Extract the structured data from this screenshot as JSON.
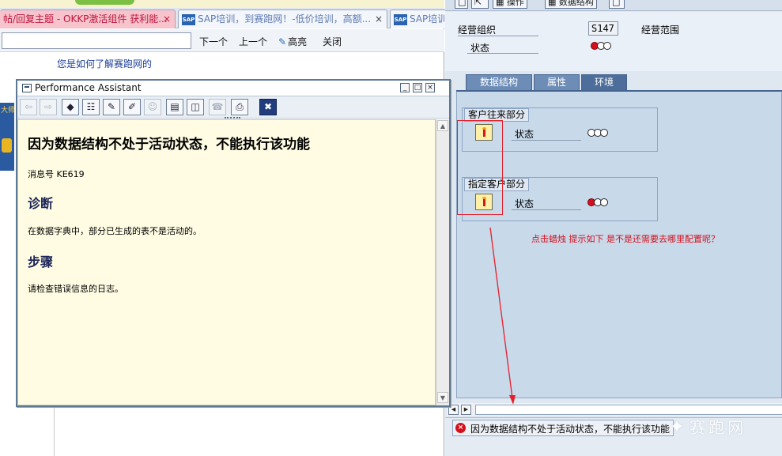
{
  "browser": {
    "tabs": [
      {
        "label": "帖/回复主题 - OKKP激活组件 获利能...",
        "close": "×"
      },
      {
        "label": "SAP培训，到赛跑网！-低价培训，高额...",
        "logo": "SAP",
        "close": "×"
      },
      {
        "label": "SAP培训",
        "logo": "SAP"
      }
    ],
    "find": {
      "value": "",
      "next": "下一个",
      "prev": "上一个",
      "highlight": "高亮",
      "close": "关闭"
    },
    "help_link": "您是如何了解赛跑网的",
    "side_label": "大师"
  },
  "pa": {
    "title": "Performance Assistant",
    "toolbar": [
      "⇦",
      "⇨",
      "◆",
      "☷",
      "✎",
      "✐",
      "☺",
      "▤",
      "◫",
      "☎",
      "⎙",
      "✖"
    ],
    "heading": "因为数据结构不处于活动状态，不能执行该功能",
    "msg_no": "消息号  KE619",
    "diag_title": "诊断",
    "diag_text": "在数据字典中，部分已生成的表不是活动的。",
    "steps_title": "步骤",
    "steps_text": "请检查错误信息的日志。"
  },
  "sap": {
    "toolbar": {
      "ops": "操作",
      "datastruct": "数据结构"
    },
    "org_label": "经营组织",
    "org_value": "S147",
    "scope_label": "经营范围",
    "status_label": "状态",
    "tabs": [
      "数据结构",
      "属性",
      "环境"
    ],
    "group1": {
      "title": "客户往来部分",
      "status": "状态"
    },
    "group2": {
      "title": "指定客户部分",
      "status": "状态"
    },
    "annotation": "点击蜡烛 提示如下  是不是还需要去哪里配置呢？",
    "status_message": "因为数据结构不处于活动状态，不能执行该功能",
    "watermark": "赛跑网"
  }
}
